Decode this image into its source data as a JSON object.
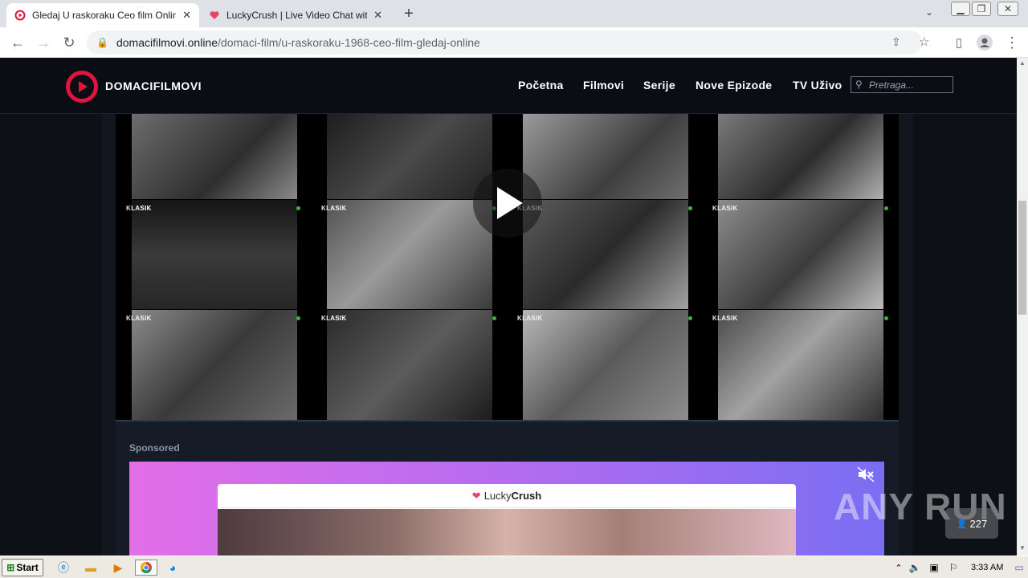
{
  "browser": {
    "tabs": [
      {
        "title": "Gledaj U raskoraku Ceo film Online",
        "active": true
      },
      {
        "title": "LuckyCrush | Live Video Chat with R",
        "active": false
      }
    ],
    "new_tab_icon": "plus-icon",
    "url_host": "domacifilmovi.online",
    "url_path": "/domaci-film/u-raskoraku-1968-ceo-film-gledaj-online"
  },
  "site": {
    "logo_text": "DOMACIFILMOVI",
    "nav": [
      "Početna",
      "Filmovi",
      "Serije",
      "Nove Epizode",
      "TV Uživo"
    ],
    "search_placeholder": "Pretraga...",
    "thumbnail_label": "KLASIK",
    "sponsored_label": "Sponsored",
    "ad_brand_prefix": "Lucky",
    "ad_brand_suffix": "Crush"
  },
  "overlay": {
    "watermark": "ANY RUN",
    "viewer_count": "227"
  },
  "taskbar": {
    "start_label": "Start",
    "time": "3:33 AM"
  },
  "colors": {
    "brand_red": "#e0143c",
    "header_bg": "#0b0d14",
    "ad_gradient_start": "#e36ee8",
    "ad_gradient_end": "#7a6ef2"
  }
}
